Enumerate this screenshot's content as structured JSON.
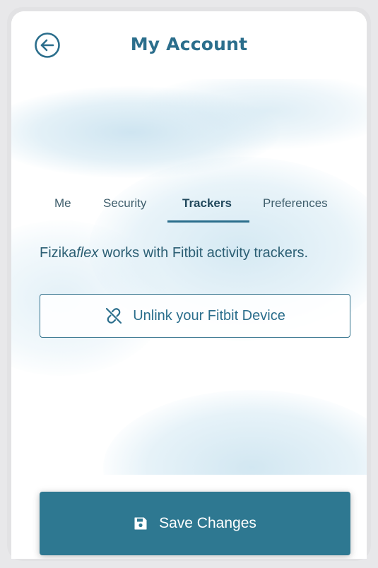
{
  "header": {
    "title": "My Account",
    "back_icon": "arrow-left-circle-icon"
  },
  "tabs": [
    {
      "label": "Me",
      "active": false
    },
    {
      "label": "Security",
      "active": false
    },
    {
      "label": "Trackers",
      "active": true
    },
    {
      "label": "Preferences",
      "active": false
    }
  ],
  "trackers": {
    "brand_prefix": "Fizika",
    "brand_suffix": "flex",
    "description_rest": " works with Fitbit activity trackers.",
    "unlink_button": {
      "label": "Unlink your Fitbit Device",
      "icon": "unlink-icon"
    }
  },
  "footer": {
    "save_button": {
      "label": "Save Changes",
      "icon": "floppy-disk-icon"
    }
  },
  "colors": {
    "primary": "#2b6e8c",
    "save_button_bg": "#2e7891",
    "watercolor": "#cfe6f1"
  }
}
